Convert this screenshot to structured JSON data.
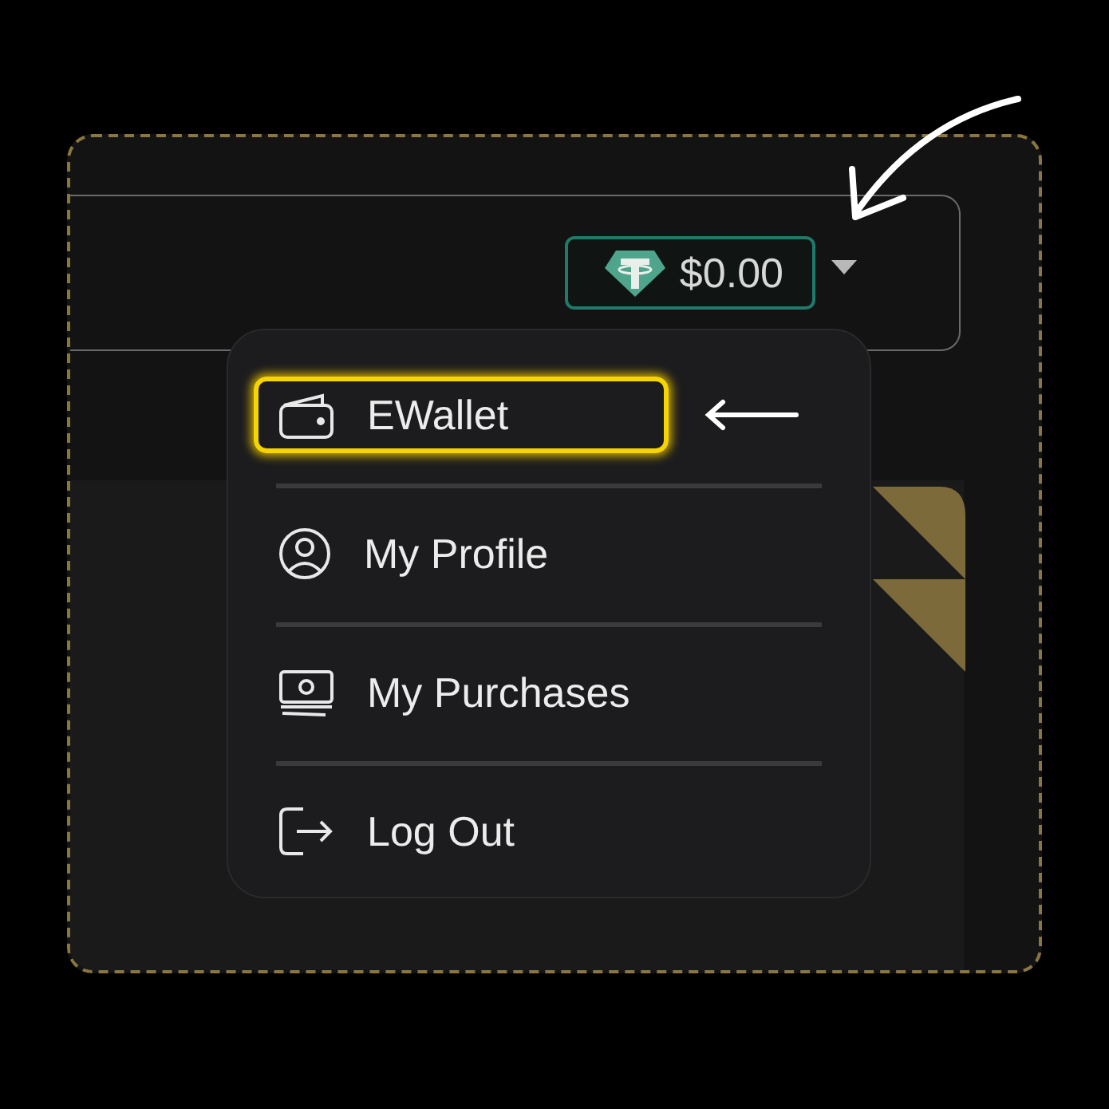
{
  "balance": {
    "amount": "$0.00"
  },
  "menu": {
    "items": [
      {
        "label": "EWallet",
        "highlighted": true
      },
      {
        "label": "My Profile",
        "highlighted": false
      },
      {
        "label": "My Purchases",
        "highlighted": false
      },
      {
        "label": "Log Out",
        "highlighted": false
      }
    ]
  }
}
